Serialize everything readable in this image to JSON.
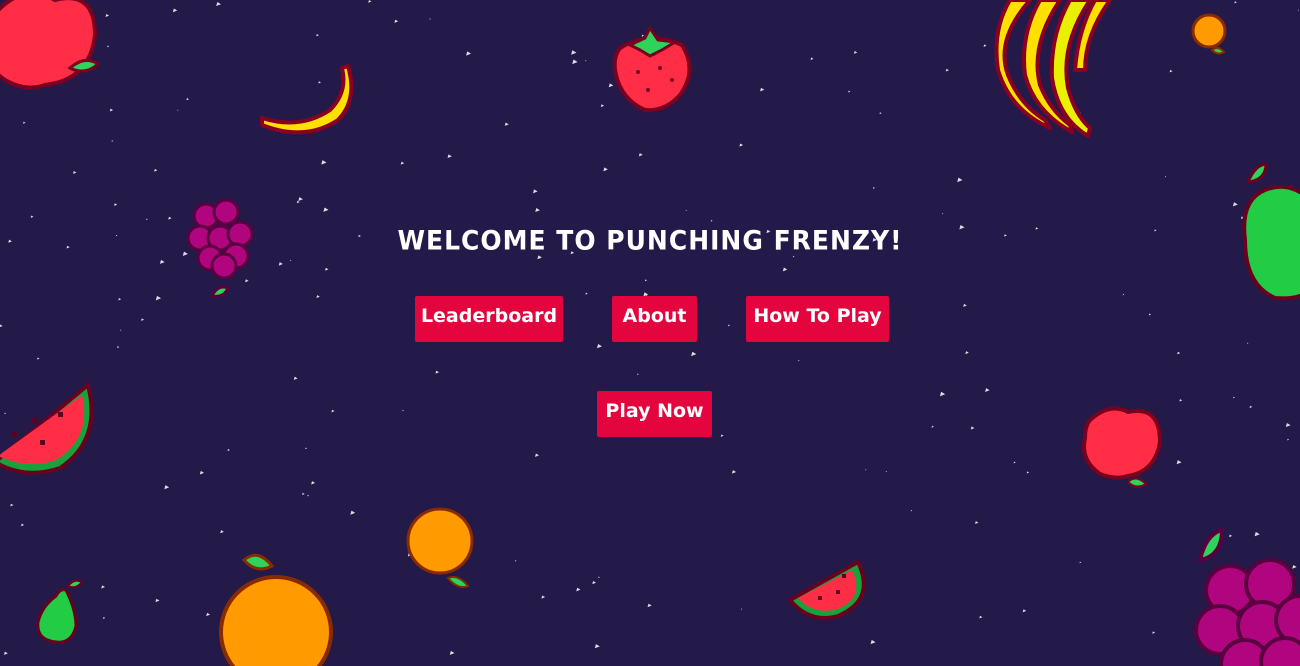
{
  "game": {
    "title": "Welcome To Punching Frenzy!",
    "menu": {
      "leaderboard_label": "Leaderboard",
      "about_label": "About",
      "how_to_play_label": "How To Play",
      "play_now_label": "Play Now"
    }
  },
  "colors": {
    "background": "#241a4a",
    "button": "#e4053e",
    "button_text": "#ffffff",
    "title_text": "#ffffff"
  },
  "decorations": [
    "apple-icon",
    "banana-icon",
    "strawberry-icon",
    "orange-icon",
    "grapes-icon",
    "pear-icon",
    "watermelon-icon"
  ]
}
